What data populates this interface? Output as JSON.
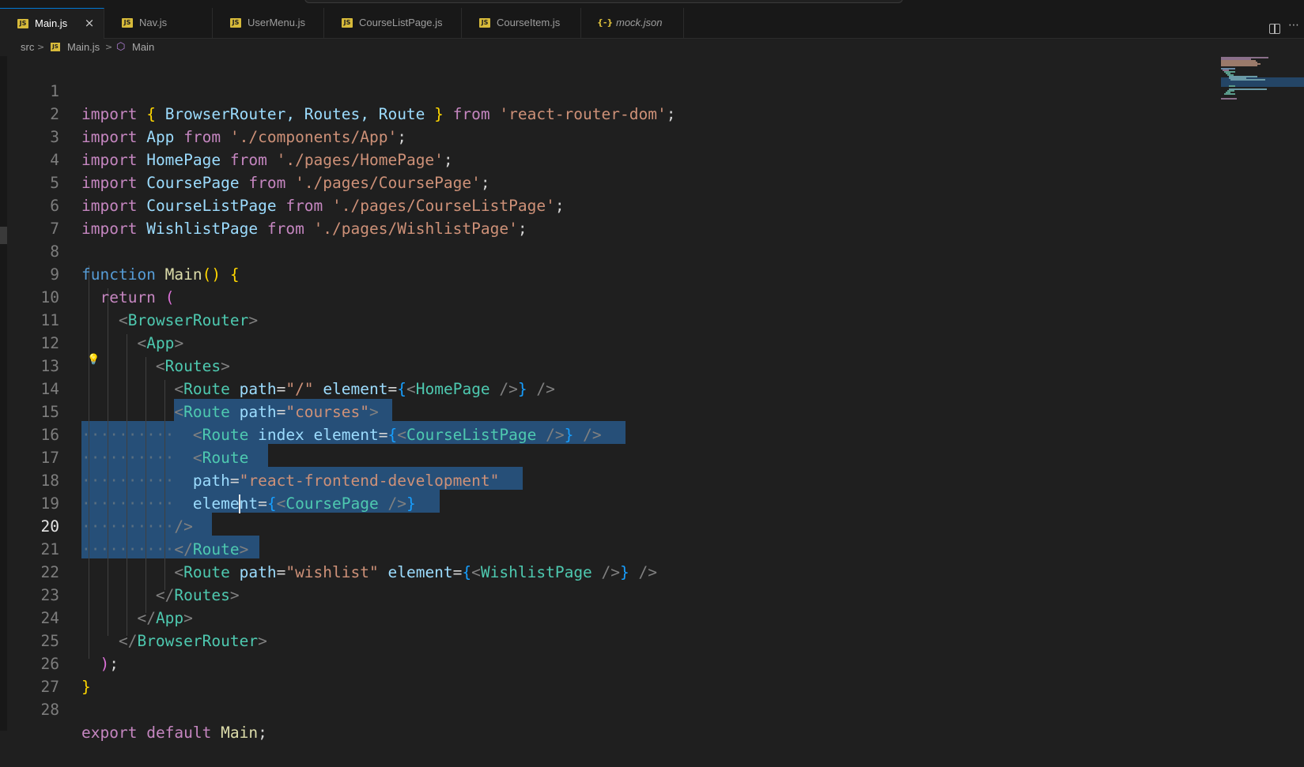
{
  "tabs": [
    {
      "label": "Main.js",
      "icon": "js-file-icon",
      "active": true,
      "close": "×"
    },
    {
      "label": "Nav.js",
      "icon": "js-file-icon",
      "active": false
    },
    {
      "label": "UserMenu.js",
      "icon": "js-file-icon",
      "active": false
    },
    {
      "label": "CourseListPage.js",
      "icon": "js-file-icon",
      "active": false
    },
    {
      "label": "CourseItem.js",
      "icon": "js-file-icon",
      "active": false
    },
    {
      "label": "mock.json",
      "icon": "json-file-icon",
      "active": false
    }
  ],
  "icons": {
    "js": "JS",
    "json": "{-}"
  },
  "breadcrumb": {
    "folder": "src",
    "file": "Main.js",
    "symbol": "Main",
    "sep": ">",
    "symbol_icon": "⬡"
  },
  "editor": {
    "current_line": 20,
    "selection_colour": "#264f78",
    "lines": [
      "1",
      "2",
      "3",
      "4",
      "5",
      "6",
      "7",
      "8",
      "9",
      "10",
      "11",
      "12",
      "13",
      "14",
      "15",
      "16",
      "17",
      "18",
      "19",
      "20",
      "21",
      "22",
      "23",
      "24",
      "25",
      "26",
      "27",
      "28"
    ],
    "code": {
      "l1": [
        "import",
        " ",
        "{",
        " BrowserRouter, Routes, Route ",
        "}",
        " ",
        "from",
        " ",
        "'react-router-dom'",
        ";"
      ],
      "l2": [
        "import",
        " ",
        "App",
        " ",
        "from",
        " ",
        "'./components/App'",
        ";"
      ],
      "l3": [
        "import",
        " ",
        "HomePage",
        " ",
        "from",
        " ",
        "'./pages/HomePage'",
        ";"
      ],
      "l4": [
        "import",
        " ",
        "CoursePage",
        " ",
        "from",
        " ",
        "'./pages/CoursePage'",
        ";"
      ],
      "l5": [
        "import",
        " ",
        "CourseListPage",
        " ",
        "from",
        " ",
        "'./pages/CourseListPage'",
        ";"
      ],
      "l6": [
        "import",
        " ",
        "WishlistPage",
        " ",
        "from",
        " ",
        "'./pages/WishlistPage'",
        ";"
      ],
      "l8": [
        "function",
        " ",
        "Main",
        "()",
        " ",
        "{"
      ],
      "l9": [
        "  ",
        "return",
        " ",
        "("
      ],
      "l10": [
        "    ",
        "<",
        "BrowserRouter",
        ">"
      ],
      "l11": [
        "      ",
        "<",
        "App",
        ">"
      ],
      "l12": [
        "        ",
        "<",
        "Routes",
        ">"
      ],
      "l13": [
        "          ",
        "<",
        "Route",
        " ",
        "path",
        "=",
        "\"/\"",
        " ",
        "element",
        "=",
        "{",
        "<",
        "HomePage",
        " />",
        "}",
        " />"
      ],
      "l14": [
        "          ",
        "<",
        "Route",
        " ",
        "path",
        "=",
        "\"courses\"",
        ">"
      ],
      "l15": [
        "··········",
        "  ",
        "<",
        "Route",
        " ",
        "index",
        " ",
        "element",
        "=",
        "{",
        "<",
        "CourseListPage",
        " />",
        "}",
        " />"
      ],
      "l16": [
        "··········",
        "  ",
        "<",
        "Route"
      ],
      "l17": [
        "··········",
        "  ",
        "path",
        "=",
        "\"react-frontend-development\""
      ],
      "l18": [
        "··········",
        "  ",
        "element",
        "=",
        "{",
        "<",
        "CoursePage",
        " />",
        "}"
      ],
      "l19": [
        "··········",
        "/>"
      ],
      "l20": [
        "··········",
        "</",
        "Route",
        ">"
      ],
      "l21": [
        "          ",
        "<",
        "Route",
        " ",
        "path",
        "=",
        "\"wishlist\"",
        " ",
        "element",
        "=",
        "{",
        "<",
        "WishlistPage",
        " />",
        "}",
        " />"
      ],
      "l22": [
        "        ",
        "</",
        "Routes",
        ">"
      ],
      "l23": [
        "      ",
        "</",
        "App",
        ">"
      ],
      "l24": [
        "    ",
        "</",
        "BrowserRouter",
        ">"
      ],
      "l25": [
        "  ",
        ")",
        ";"
      ],
      "l26": [
        "}"
      ],
      "l28": [
        "export",
        " ",
        "default",
        " ",
        "Main",
        ";"
      ]
    }
  }
}
